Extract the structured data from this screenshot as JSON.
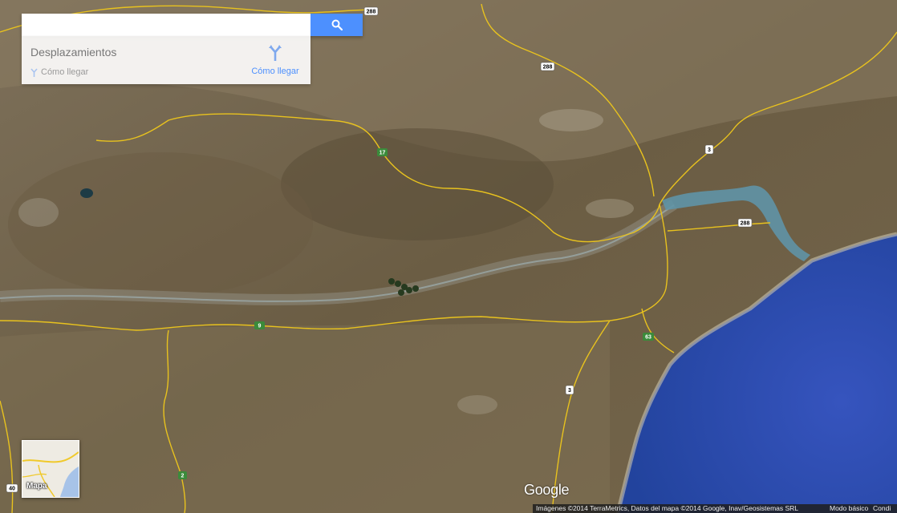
{
  "search": {
    "placeholder": "",
    "button_icon": "search-icon"
  },
  "panel": {
    "title": "Desplazamientos",
    "sub_link": "Cómo llegar",
    "directions_label": "Cómo llegar",
    "directions_icon": "directions-icon"
  },
  "map": {
    "type": "satellite",
    "road_labels": [
      "288",
      "288",
      "3",
      "17",
      "288",
      "9",
      "63",
      "3",
      "2",
      "40"
    ]
  },
  "layer_toggle": {
    "label": "Mapa"
  },
  "logo": "Google",
  "footer": {
    "attribution": "Imágenes ©2014 TerraMetrics, Datos del mapa ©2014 Google, Inav/Geosistemas SRL",
    "mode": "Modo básico",
    "terms": "Condi"
  },
  "colors": {
    "accent": "#4d90fe",
    "road": "#e8c21e",
    "sea": "#2c4cb3"
  }
}
